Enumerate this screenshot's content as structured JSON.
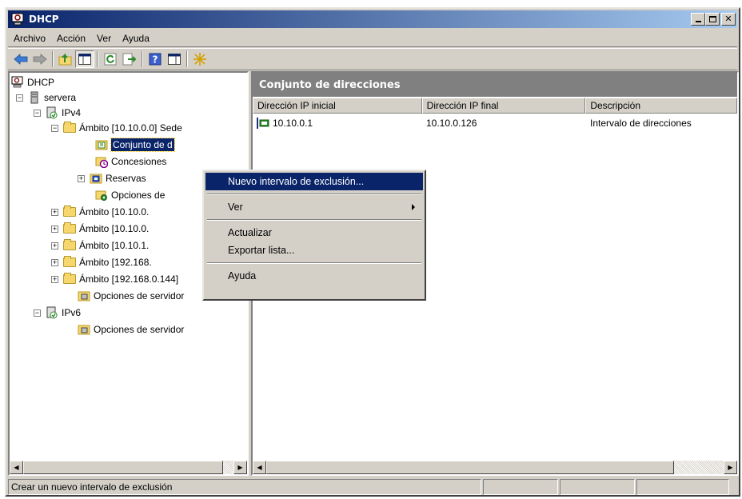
{
  "window": {
    "title": "DHCP"
  },
  "menubar": {
    "items": [
      "Archivo",
      "Acción",
      "Ver",
      "Ayuda"
    ]
  },
  "toolbar": {
    "buttons": [
      "back-icon",
      "forward-icon",
      "up-folder-icon",
      "show-hide-tree-icon",
      "refresh-icon",
      "export-list-icon",
      "help-icon",
      "properties-icon",
      "new-star-icon"
    ]
  },
  "tree": {
    "root": "DHCP",
    "server": "servera",
    "ipv4": "IPv4",
    "scope_sede": "Ámbito [10.10.0.0] Sede",
    "pool": "Conjunto de d",
    "leases": "Concesiones",
    "reservations": "Reservas",
    "scope_options": "Opciones de",
    "scope2": "Ámbito [10.10.0.",
    "scope3": "Ámbito [10.10.0.",
    "scope4": "Ámbito [10.10.1.",
    "scope5": "Ámbito [192.168.",
    "scope6": "Ámbito [192.168.0.144]",
    "server_options_v4": "Opciones de servidor",
    "ipv6": "IPv6",
    "server_options_v6": "Opciones de servidor"
  },
  "right_pane": {
    "title": "Conjunto de direcciones",
    "columns": [
      "Dirección IP inicial",
      "Dirección IP final",
      "Descripción"
    ],
    "rows": [
      {
        "start": "10.10.0.1",
        "end": "10.10.0.126",
        "desc": "Intervalo de direcciones"
      }
    ]
  },
  "context_menu": {
    "new_exclusion": "Nuevo intervalo de exclusión...",
    "view": "Ver",
    "refresh": "Actualizar",
    "export": "Exportar lista...",
    "help": "Ayuda"
  },
  "statusbar": {
    "text": "Crear un nuevo intervalo de exclusión"
  },
  "colors": {
    "title_start": "#0a246a",
    "title_end": "#a6caf0",
    "face": "#d4d0c8",
    "selection": "#0a246a",
    "pane_header": "#808080"
  }
}
